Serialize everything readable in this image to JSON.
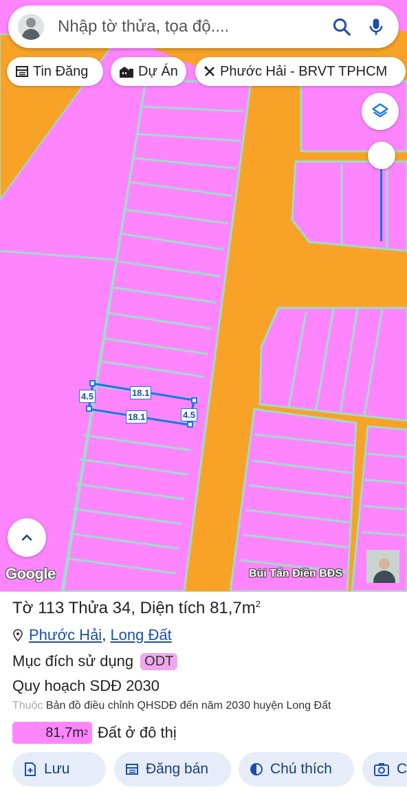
{
  "search": {
    "placeholder": "Nhập tờ thửa, tọa độ...."
  },
  "chips": {
    "tin_dang": "Tin Đăng",
    "du_an": "Dự Án",
    "region": "Phước Hải - BRVT TPHCM"
  },
  "map": {
    "dimension_labels": [
      "4.5",
      "18.1",
      "18.1",
      "4.5"
    ],
    "attribution": "Google",
    "watermark": "Bùi Tấn Điền BĐS",
    "colors": {
      "residential": "#ff85ff",
      "road": "#f8a327",
      "boundary": "#9fdcc7",
      "selection": "#1a73e8"
    }
  },
  "parcel": {
    "title_prefix": "Tờ 113 Thửa 34, Diện tích 81,7m",
    "title_sup": "2",
    "ward": "Phước Hải",
    "separator": ",",
    "district": "Long Đất",
    "purpose_label": "Mục đích sử dụng",
    "purpose_code": "ODT",
    "plan_title": "Quy hoạch SDĐ 2030",
    "doc_prefix": "Thuộc",
    "doc_text": "Bản đồ điều chỉnh QHSDĐ đến năm 2030 huyện Long Đất",
    "area_value": "81,7m",
    "area_sup": "2",
    "area_label": "Đất ở đô thị"
  },
  "actions": {
    "save": "Lưu",
    "post": "Đăng bán",
    "legend": "Chú thích",
    "camera": "C"
  }
}
